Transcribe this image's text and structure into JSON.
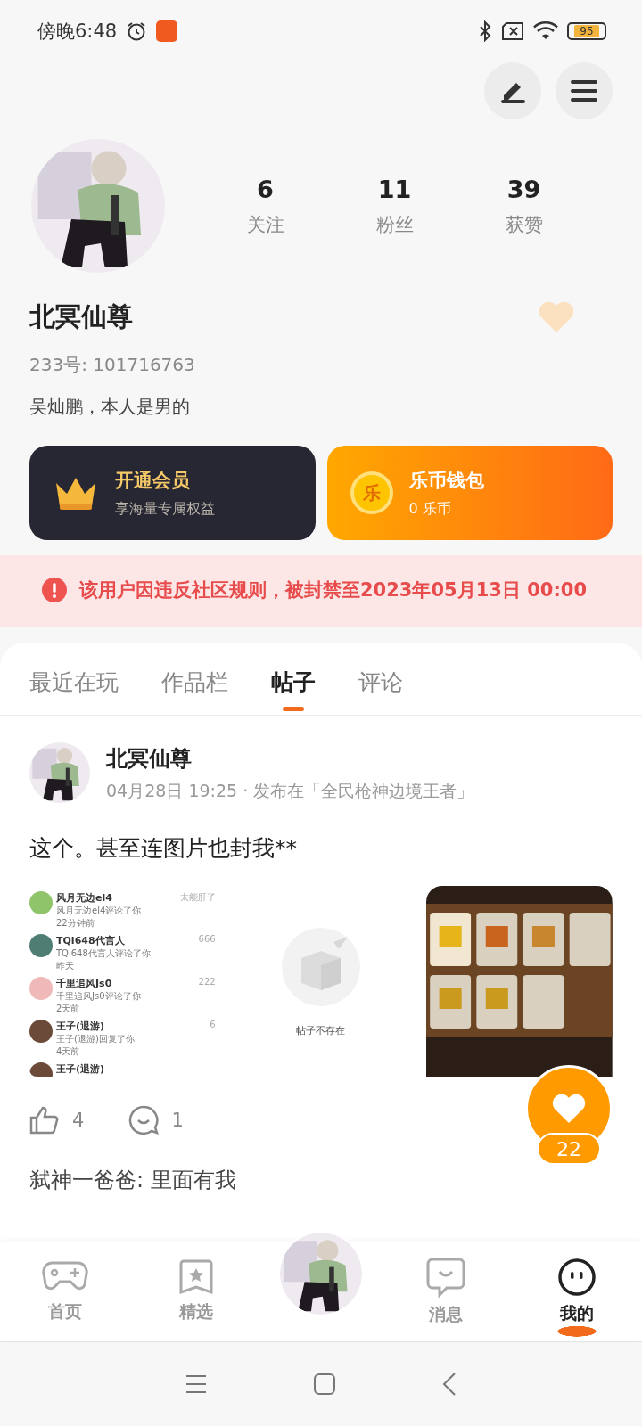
{
  "status_bar": {
    "time": "傍晚6:48",
    "battery": "95"
  },
  "profile": {
    "stats": [
      {
        "value": "6",
        "label": "关注"
      },
      {
        "value": "11",
        "label": "粉丝"
      },
      {
        "value": "39",
        "label": "获赞"
      }
    ],
    "name": "北冥仙尊",
    "id_label": "233号: 101716763",
    "bio": "吴灿鹏，本人是男的",
    "cards": [
      {
        "kind": "vip",
        "title": "开通会员",
        "subtitle": "享海量专属权益"
      },
      {
        "kind": "wallet",
        "title": "乐币钱包",
        "subtitle": "0 乐币",
        "badge": "乐"
      }
    ]
  },
  "ban_notice": "该用户因违反社区规则，被封禁至2023年05月13日 00:00",
  "tabs": [
    {
      "label": "最近在玩",
      "selected": false
    },
    {
      "label": "作品栏",
      "selected": false
    },
    {
      "label": "帖子",
      "selected": true
    },
    {
      "label": "评论",
      "selected": false
    }
  ],
  "post": {
    "author": "北冥仙尊",
    "meta": "04月28日 19:25 · 发布在「全民枪神边境王者」",
    "text": "这个。甚至连图片也封我**",
    "images": [
      {
        "kind": "screenshot",
        "rows": [
          {
            "name": "风月无边el4",
            "action": "风月无边el4评论了你",
            "time": "22分钟前",
            "reply": "太能肝了",
            "color": "#8fc46a"
          },
          {
            "name": "TQl648代言人",
            "action": "TQl648代言人评论了你",
            "time": "昨天",
            "reply": "666",
            "color": "#4f7d74"
          },
          {
            "name": "千里追风Js0",
            "action": "千里追风Js0评论了你",
            "time": "2天前",
            "reply": "222",
            "color": "#f0b9b9"
          },
          {
            "name": "王子(退游)",
            "action": "王子(退游)回复了你",
            "time": "4天前",
            "reply": "6",
            "color": "#6b4a3a"
          },
          {
            "name": "王子(退游)",
            "color": "#6b4a3a"
          }
        ]
      },
      {
        "kind": "empty",
        "text": "帖子不存在"
      },
      {
        "kind": "picture"
      }
    ],
    "likes": "4",
    "comments": "1",
    "float_count": "22",
    "comment": "弑神一爸爸: 里面有我"
  },
  "nav": [
    {
      "kind": "game",
      "label": "首页",
      "selected": false
    },
    {
      "kind": "star",
      "label": "精选",
      "selected": false
    },
    {
      "kind": "avatar"
    },
    {
      "kind": "chat",
      "label": "消息",
      "selected": false
    },
    {
      "kind": "me",
      "label": "我的",
      "selected": true
    }
  ]
}
